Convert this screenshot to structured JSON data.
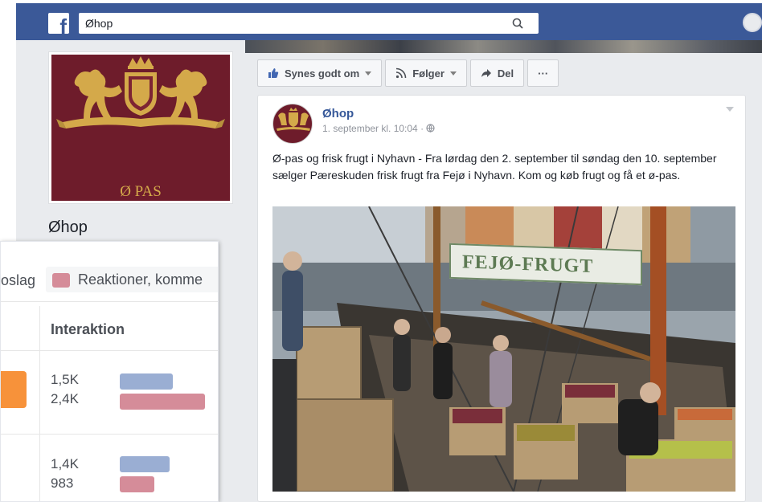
{
  "facebook": {
    "logo": "f",
    "search": {
      "value": "Øhop",
      "icon": "search-icon"
    }
  },
  "page": {
    "name": "Øhop",
    "profile_caption": "Ø PAS"
  },
  "actions": [
    {
      "label": "Synes godt om",
      "icon": "thumbs-up-icon"
    },
    {
      "label": "Følger",
      "icon": "rss-icon"
    },
    {
      "label": "Del",
      "icon": "share-arrow-icon"
    },
    {
      "label": "···",
      "icon": "more-icon"
    }
  ],
  "post": {
    "author": "Øhop",
    "time": "1. september kl. 10:04 · ",
    "text": "Ø-pas og frisk frugt i Nyhavn - Fra lørdag den 2. september til søndag den 10. september sælger Pæreskuden frisk frugt fra Fejø i Nyhavn. Kom og køb frugt og få et ø-pas.",
    "photo_sign": "FEJØ-FRUGT"
  },
  "stats": {
    "legend_item_1": "oslag",
    "legend_item_2": "Reaktioner, komme",
    "column_header": "Interaktion",
    "rows": [
      {
        "blue_value": "1,5K",
        "pink_value": "2,4K",
        "blue_count": 1500,
        "pink_count": 2400
      },
      {
        "blue_value": "1,4K",
        "pink_value": "983",
        "blue_count": 1400,
        "pink_count": 983
      }
    ]
  },
  "colors": {
    "facebook_blue": "#3b5998",
    "link_blue": "#365899",
    "bar_blue": "#9aaed3",
    "bar_pink": "#d58c99",
    "highlight_orange": "#f7923a",
    "logo_gold": "#d4a94a",
    "logo_maroon": "#6e1c2b"
  }
}
